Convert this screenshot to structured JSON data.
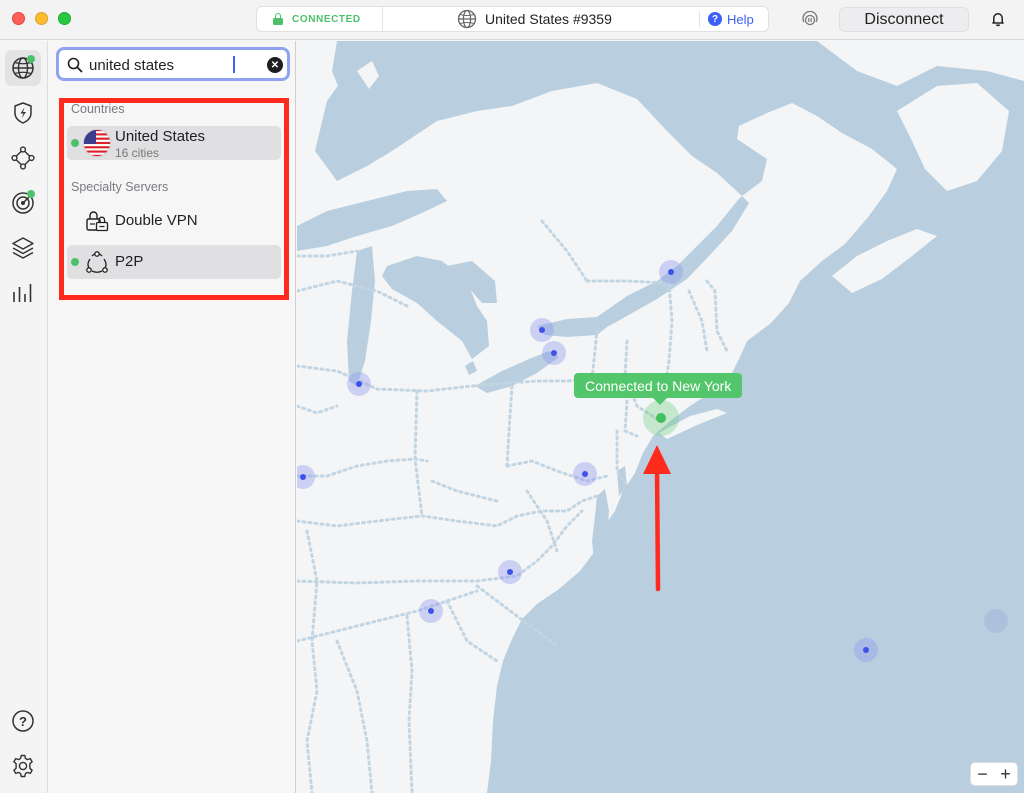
{
  "titlebar": {
    "status": "CONNECTED",
    "server": "United States #9359",
    "help": "Help",
    "help_glyph": "?",
    "disconnect": "Disconnect"
  },
  "rail": {
    "items": [
      {
        "name": "globe-icon",
        "active": true,
        "dot": true
      },
      {
        "name": "threat-protection-icon",
        "active": false,
        "dot": false
      },
      {
        "name": "meshnet-icon",
        "active": false,
        "dot": false
      },
      {
        "name": "dark-web-monitor-icon",
        "active": false,
        "dot": true
      },
      {
        "name": "layers-icon",
        "active": false,
        "dot": false
      },
      {
        "name": "stats-icon",
        "active": false,
        "dot": false
      }
    ],
    "bottom": [
      {
        "name": "help-circle-icon",
        "glyph": "?"
      },
      {
        "name": "settings-gear-icon"
      }
    ]
  },
  "search": {
    "query": "united states",
    "clear_glyph": "✕"
  },
  "results": {
    "countries_label": "Countries",
    "countries": [
      {
        "title": "United States",
        "subtitle": "16 cities",
        "icon": "us-flag-icon",
        "connected": true
      }
    ],
    "specialty_label": "Specialty Servers",
    "specialty": [
      {
        "title": "Double VPN",
        "icon": "double-vpn-locks-icon",
        "connected": false
      },
      {
        "title": "P2P",
        "icon": "p2p-network-icon",
        "connected": true
      }
    ]
  },
  "map": {
    "connected_label": "Connected to New York",
    "zoom_out": "−",
    "zoom_in": "+"
  },
  "colors": {
    "accent": "#3e5ff5",
    "connected_green": "#4cc16a",
    "annotation_red": "#ff2a1e",
    "water": "#b9cfdf",
    "land": "#f4f5f6"
  }
}
